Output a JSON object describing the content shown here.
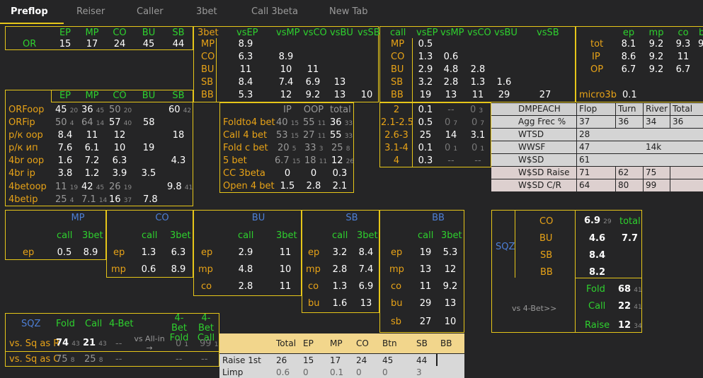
{
  "tabs": [
    "Preflop",
    "Reiser",
    "Caller",
    "3bet",
    "Call 3beta",
    "New Tab"
  ],
  "or_panel": {
    "headers": [
      "EP",
      "MP",
      "CO",
      "BU",
      "SB"
    ],
    "label": "OR",
    "values": [
      "15",
      "17",
      "24",
      "45",
      "44"
    ]
  },
  "threebet": {
    "headers": [
      "3bet",
      "vsEP",
      "vsMP",
      "vsCO",
      "vsBU",
      "vsSB"
    ],
    "rows": [
      [
        "MP",
        "8.9",
        "",
        "",
        "",
        ""
      ],
      [
        "CO",
        "6.3",
        "8.9",
        "",
        "",
        ""
      ],
      [
        "BU",
        "11",
        "10",
        "11",
        "",
        ""
      ],
      [
        "SB",
        "8.4",
        "7.4",
        "6.9",
        "13",
        ""
      ],
      [
        "BB",
        "5.3",
        "12",
        "9.2",
        "13",
        "10"
      ]
    ]
  },
  "call": {
    "headers": [
      "call",
      "vsEP",
      "vsMP",
      "vsCO",
      "vsBU",
      "vsSB"
    ],
    "rows": [
      [
        "MP",
        "0.5",
        "",
        "",
        "",
        ""
      ],
      [
        "CO",
        "1.3",
        "0.6",
        "",
        "",
        ""
      ],
      [
        "BU",
        "2.9",
        "4.8",
        "2.8",
        "",
        ""
      ],
      [
        "SB",
        "3.2",
        "2.8",
        "1.3",
        "1.6",
        ""
      ],
      [
        "BB",
        "19",
        "13",
        "11",
        "29",
        "27"
      ]
    ]
  },
  "tot_panel": {
    "headers": [
      "ep",
      "mp",
      "co",
      "b"
    ],
    "rows": [
      [
        "tot",
        "8.1",
        "9.2",
        "9.3",
        "9"
      ],
      [
        "IP",
        "8.6",
        "9.2",
        "11",
        ""
      ],
      [
        "OP",
        "6.7",
        "9.2",
        "6.7",
        ""
      ]
    ],
    "micro_label": "micro3b",
    "micro_value": "0.1"
  },
  "orfoop": {
    "headers": [
      "EP",
      "MP",
      "CO",
      "BU",
      "SB"
    ],
    "rows": [
      {
        "label": "ORFoop",
        "cells": [
          [
            "45",
            "20"
          ],
          [
            "36",
            "45"
          ],
          [
            "50",
            "20"
          ],
          [
            "",
            ""
          ],
          [
            "60",
            "42"
          ]
        ]
      },
      {
        "label": "ORFip",
        "cells": [
          [
            "50",
            "4"
          ],
          [
            "64",
            "14"
          ],
          [
            "57",
            "40"
          ],
          [
            "58",
            ""
          ],
          [
            "",
            ""
          ]
        ]
      },
      {
        "label": "р/к оор",
        "cells": [
          [
            "8.4",
            ""
          ],
          [
            "11",
            ""
          ],
          [
            "12",
            ""
          ],
          [
            "",
            ""
          ],
          [
            "18",
            ""
          ]
        ]
      },
      {
        "label": "р/к ип",
        "cells": [
          [
            "7.6",
            ""
          ],
          [
            "6.1",
            ""
          ],
          [
            "10",
            ""
          ],
          [
            "19",
            ""
          ],
          [
            "",
            ""
          ]
        ]
      },
      {
        "label": "4br oop",
        "cells": [
          [
            "1.6",
            ""
          ],
          [
            "7.2",
            ""
          ],
          [
            "6.3",
            ""
          ],
          [
            "",
            ""
          ],
          [
            "4.3",
            ""
          ]
        ]
      },
      {
        "label": "4br ip",
        "cells": [
          [
            "3.8",
            ""
          ],
          [
            "1.2",
            ""
          ],
          [
            "3.9",
            ""
          ],
          [
            "3.5",
            ""
          ],
          [
            "",
            ""
          ]
        ]
      },
      {
        "label": "4betoop",
        "cells": [
          [
            "11",
            "19"
          ],
          [
            "42",
            "45"
          ],
          [
            "26",
            "19"
          ],
          [
            "",
            ""
          ],
          [
            "9.8",
            "41"
          ]
        ]
      },
      {
        "label": "4betip",
        "cells": [
          [
            "25",
            "4"
          ],
          [
            "7.1",
            "14"
          ],
          [
            "16",
            "37"
          ],
          [
            "7.8",
            ""
          ],
          [
            "",
            ""
          ]
        ]
      }
    ]
  },
  "fold4": {
    "headers": [
      "IP",
      "OOP",
      "total"
    ],
    "rows": [
      {
        "label": "Foldto4 bet",
        "cells": [
          [
            "40",
            "15"
          ],
          [
            "55",
            "11"
          ],
          [
            "36",
            "33"
          ]
        ]
      },
      {
        "label": "Call 4 bet",
        "cells": [
          [
            "53",
            "15"
          ],
          [
            "27",
            "11"
          ],
          [
            "55",
            "33"
          ]
        ]
      },
      {
        "label": "Fold c bet",
        "cells": [
          [
            "20",
            "5"
          ],
          [
            "33",
            "3"
          ],
          [
            "25",
            "8"
          ]
        ]
      },
      {
        "label": "5 bet",
        "cells": [
          [
            "6.7",
            "15"
          ],
          [
            "18",
            "11"
          ],
          [
            "12",
            "26"
          ]
        ]
      },
      {
        "label": "CC 3beta",
        "cells": [
          [
            "0",
            ""
          ],
          [
            "0",
            ""
          ],
          [
            "0.3",
            ""
          ]
        ]
      },
      {
        "label": "Open 4 bet",
        "cells": [
          [
            "1.5",
            ""
          ],
          [
            "2.8",
            ""
          ],
          [
            "2.1",
            ""
          ]
        ]
      }
    ]
  },
  "sizing": {
    "rows": [
      [
        "2",
        "0.1",
        "--",
        "0",
        "3"
      ],
      [
        "2.1-2.5",
        "0.5",
        "0",
        "7",
        "0",
        "7"
      ],
      [
        "2.6-3",
        "25",
        "14",
        "3.1"
      ],
      [
        "3.1-4",
        "0.1",
        "0",
        "1",
        "0",
        "1"
      ],
      [
        "4",
        "0.3",
        "--",
        "--"
      ]
    ]
  },
  "dmpeach": {
    "headers": [
      "DMPEACH",
      "Flop",
      "Turn",
      "River",
      "Total"
    ],
    "rows": [
      [
        "Agg Frec %",
        "37",
        "36",
        "34",
        "36"
      ],
      [
        "WTSD",
        "28",
        "",
        "",
        ""
      ],
      [
        "WWSF",
        "47",
        "",
        "14k",
        ""
      ],
      [
        "W$SD",
        "61",
        "",
        "",
        ""
      ],
      [
        "W$SD Raise",
        "71",
        "62",
        "75",
        ""
      ],
      [
        "W$SD C/R",
        "64",
        "80",
        "99",
        ""
      ]
    ]
  },
  "pos_panels": [
    {
      "title": "MP",
      "sub": [
        "call",
        "3bet"
      ],
      "rows": [
        [
          "ep",
          "0.5",
          "8.9"
        ]
      ]
    },
    {
      "title": "CO",
      "sub": [
        "call",
        "3bet"
      ],
      "rows": [
        [
          "ep",
          "1.3",
          "6.3"
        ],
        [
          "mp",
          "0.6",
          "8.9"
        ]
      ]
    },
    {
      "title": "BU",
      "sub": [
        "call",
        "3bet"
      ],
      "rows": [
        [
          "ep",
          "2.9",
          "11"
        ],
        [
          "mp",
          "4.8",
          "10"
        ],
        [
          "co",
          "2.8",
          "11"
        ]
      ]
    },
    {
      "title": "SB",
      "sub": [
        "call",
        "3bet"
      ],
      "rows": [
        [
          "ep",
          "3.2",
          "8.4"
        ],
        [
          "mp",
          "2.8",
          "7.4"
        ],
        [
          "co",
          "1.3",
          "6.9"
        ],
        [
          "bu",
          "1.6",
          "13"
        ]
      ]
    },
    {
      "title": "BB",
      "sub": [
        "call",
        "3bet"
      ],
      "rows": [
        [
          "ep",
          "19",
          "5.3"
        ],
        [
          "mp",
          "13",
          "12"
        ],
        [
          "co",
          "11",
          "9.2"
        ],
        [
          "bu",
          "29",
          "13"
        ],
        [
          "sb",
          "27",
          "10"
        ]
      ]
    }
  ],
  "sqz": {
    "label": "SQZ",
    "rows": [
      [
        "CO",
        "6.9",
        "29"
      ],
      [
        "BU",
        "4.6",
        ""
      ],
      [
        "SB",
        "8.4",
        ""
      ],
      [
        "BB",
        "8.2",
        ""
      ]
    ],
    "total_label": "total",
    "total_value": "7.7",
    "vs4bet": "vs 4-Bet>>",
    "fold_label": "Fold",
    "fold_value": "68",
    "fold_sub": "41",
    "call_label": "Call",
    "call_value": "22",
    "call_sub": "41",
    "raise_label": "Raise",
    "raise_value": "12",
    "raise_sub": "34"
  },
  "sqz2": {
    "label": "SQZ",
    "headers": [
      "Fold",
      "Call",
      "4-Bet",
      "",
      "4-Bet Fold",
      "4-Bet Call"
    ],
    "vs_allin": "vs All-in",
    "arrow": "→",
    "rows": [
      {
        "label": "vs. Sq as R",
        "fold": [
          "74",
          "43"
        ],
        "call": [
          "21",
          "43"
        ],
        "fourbet": "--",
        "fbf": [
          "0",
          "1"
        ],
        "fbc": [
          "99",
          "1"
        ]
      },
      {
        "label": "vs. Sq as C",
        "fold": [
          "75",
          "8"
        ],
        "call": [
          "25",
          "8"
        ],
        "fourbet": "--",
        "fbf": [
          "--",
          ""
        ],
        "fbc": [
          "--",
          ""
        ]
      }
    ]
  },
  "raise_table": {
    "headers": [
      "Total",
      "EP",
      "MP",
      "CO",
      "Btn",
      "SB",
      "BB"
    ],
    "rows": [
      {
        "label": "Raise 1st",
        "values": [
          "26",
          "15",
          "17",
          "24",
          "45",
          "44",
          ""
        ]
      },
      {
        "label": "Limp",
        "values": [
          "0.6",
          "0",
          "0.1",
          "0",
          "0",
          "3",
          ""
        ]
      }
    ]
  },
  "colors": {
    "accent": "#e6c619",
    "green": "#2ed12e",
    "orange": "#e8a317",
    "blue": "#4d7fd6",
    "bg": "#252526"
  }
}
